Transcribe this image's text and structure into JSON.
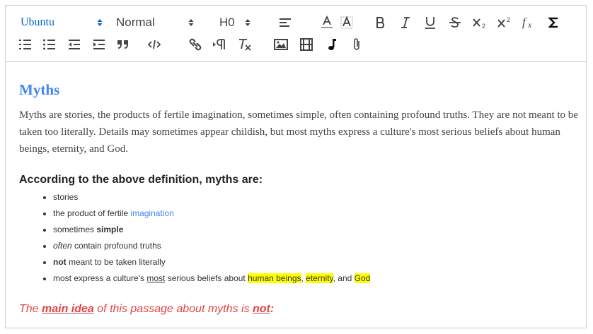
{
  "toolbar": {
    "font_picker": "Ubuntu",
    "size_picker": "Normal",
    "header_picker": "H0",
    "icons": [
      "align-left-icon",
      "font-color-icon",
      "background-color-icon",
      "bold-icon",
      "italic-icon",
      "underline-icon",
      "strikethrough-icon",
      "subscript-icon",
      "superscript-icon",
      "formula-icon",
      "sigma-icon",
      "ordered-list-icon",
      "bullet-list-icon",
      "outdent-icon",
      "indent-icon",
      "blockquote-icon",
      "code-block-icon",
      "link-icon",
      "text-direction-icon",
      "clear-format-icon",
      "image-icon",
      "video-icon",
      "audio-icon",
      "attachment-icon"
    ],
    "accent": "#06c"
  },
  "content": {
    "title": "Myths",
    "paragraph": "Myths are stories, the products of fertile imagination, sometimes simple, often containing profound truths. They are not meant to be taken too literally. Details may sometimes appear childish, but most myths express a culture's most serious beliefs about human beings, eternity, and God.",
    "subheading": "According to the above definition, myths are:",
    "list": {
      "item1": "stories",
      "item2_a": "the product of fertile ",
      "item2_b": "imagination",
      "item3_a": "sometimes ",
      "item3_b": "simple",
      "item4_a": "often",
      "item4_b": " contain profound truths",
      "item5_a": "not",
      "item5_b": " meant to be taken literally",
      "item6_a": "most express a culture's ",
      "item6_b": "most",
      "item6_c": " serious beliefs about ",
      "item6_d": "human beings",
      "item6_e": ", ",
      "item6_f": "eternity",
      "item6_g": ", and ",
      "item6_h": "God"
    },
    "main_idea": {
      "a": "The ",
      "b": "main idea",
      "c": " of this passage about myths is ",
      "d": "not",
      "e": ":"
    },
    "colors": {
      "title": "#4285f4",
      "link": "#4285f4",
      "highlight": "#ffff00",
      "idea": "#e04545"
    }
  }
}
